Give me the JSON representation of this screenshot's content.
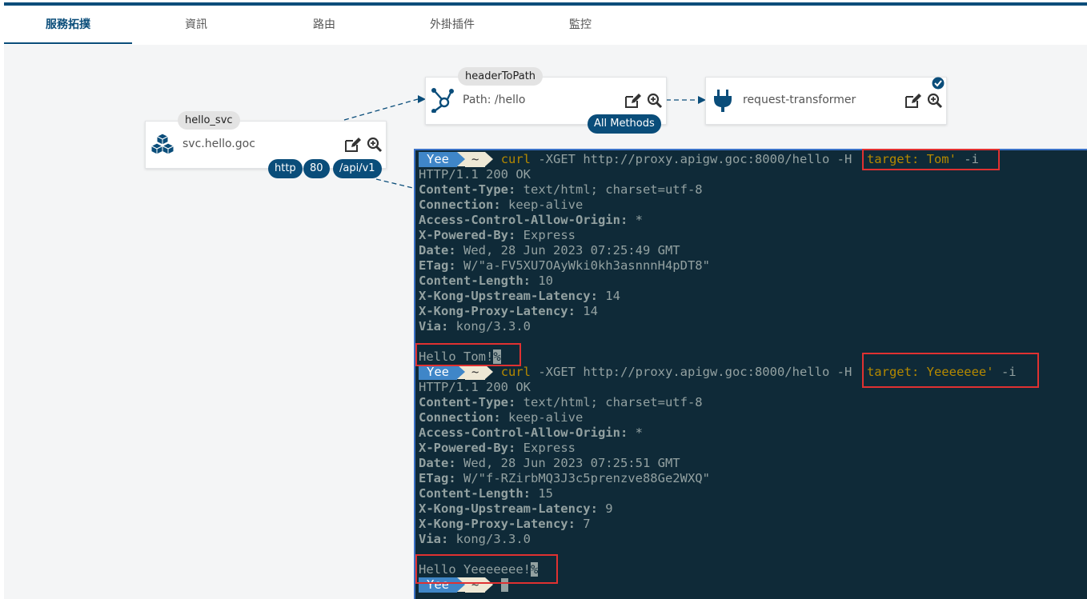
{
  "tabs": [
    {
      "label": "服務拓撲",
      "active": true
    },
    {
      "label": "資訊",
      "active": false
    },
    {
      "label": "路由",
      "active": false
    },
    {
      "label": "外掛插件",
      "active": false
    },
    {
      "label": "監控",
      "active": false
    }
  ],
  "service": {
    "name": "hello_svc",
    "host": "svc.hello.goc",
    "badges": [
      "http",
      "80",
      "/api/v1"
    ],
    "icon": "cubes-icon"
  },
  "route": {
    "name": "headerToPath",
    "path": "Path: /hello",
    "methods": "All Methods",
    "icon": "hub-icon"
  },
  "plugin": {
    "name": "request-transformer",
    "enabled": true,
    "icon": "plug-icon"
  },
  "colors": {
    "brand": "#0a4d7a",
    "terminal_bg": "#0f2a38",
    "highlight": "#e03131"
  },
  "terminal": {
    "prompt_user": "Yee",
    "prompt_dir": "~",
    "cmd1": {
      "curl": "curl",
      "url": " -XGET http://proxy.apigw.goc:8000/hello ",
      "flag": "-H",
      "header": " 'target: Tom'",
      "tail": " -i"
    },
    "out1": [
      {
        "k": "",
        "v": "HTTP/1.1 200 OK"
      },
      {
        "k": "Content-Type:",
        "v": " text/html; charset=utf-8"
      },
      {
        "k": "Connection:",
        "v": " keep-alive"
      },
      {
        "k": "Access-Control-Allow-Origin:",
        "v": " *"
      },
      {
        "k": "X-Powered-By:",
        "v": " Express"
      },
      {
        "k": "Date:",
        "v": " Wed, 28 Jun 2023 07:25:49 GMT"
      },
      {
        "k": "ETag:",
        "v": " W/\"a-FV5XU7OAyWki0kh3asnnnH4pDT8\""
      },
      {
        "k": "Content-Length:",
        "v": " 10"
      },
      {
        "k": "X-Kong-Upstream-Latency:",
        "v": " 14"
      },
      {
        "k": "X-Kong-Proxy-Latency:",
        "v": " 14"
      },
      {
        "k": "Via:",
        "v": " kong/3.3.0"
      }
    ],
    "body1": "Hello Tom!",
    "cmd2": {
      "curl": "curl",
      "url": " -XGET http://proxy.apigw.goc:8000/hello ",
      "flag": "-H",
      "header": " 'target: Yeeeeeee'",
      "tail": " -i"
    },
    "out2": [
      {
        "k": "",
        "v": "HTTP/1.1 200 OK"
      },
      {
        "k": "Content-Type:",
        "v": " text/html; charset=utf-8"
      },
      {
        "k": "Connection:",
        "v": " keep-alive"
      },
      {
        "k": "Access-Control-Allow-Origin:",
        "v": " *"
      },
      {
        "k": "X-Powered-By:",
        "v": " Express"
      },
      {
        "k": "Date:",
        "v": " Wed, 28 Jun 2023 07:25:51 GMT"
      },
      {
        "k": "ETag:",
        "v": " W/\"f-RZirbMQ3J3c5prenzve88Ge2WXQ\""
      },
      {
        "k": "Content-Length:",
        "v": " 15"
      },
      {
        "k": "X-Kong-Upstream-Latency:",
        "v": " 9"
      },
      {
        "k": "X-Kong-Proxy-Latency:",
        "v": " 7"
      },
      {
        "k": "Via:",
        "v": " kong/3.3.0"
      }
    ],
    "body2": "Hello Yeeeeeee!",
    "pct": "%"
  }
}
